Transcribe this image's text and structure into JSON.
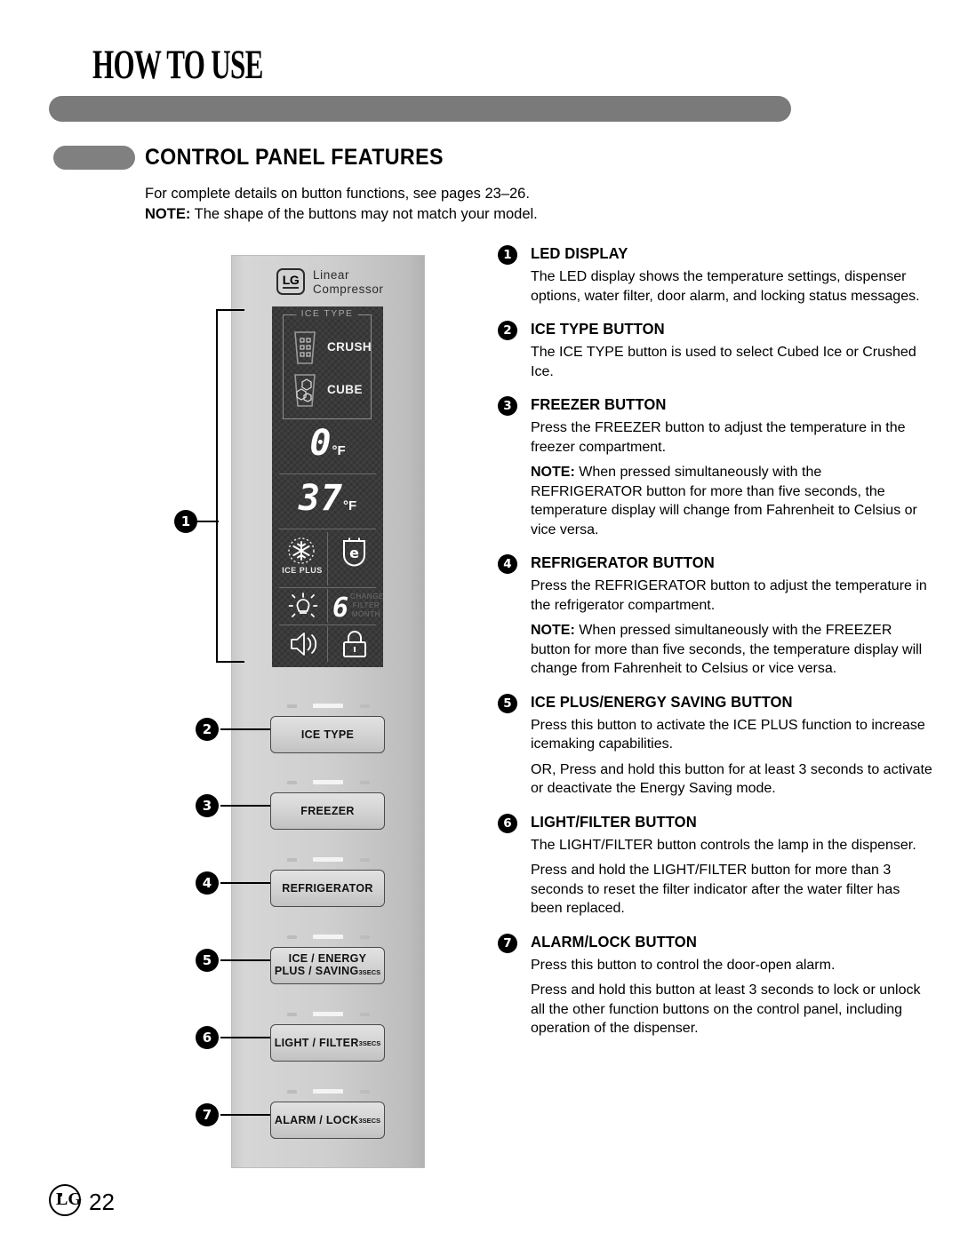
{
  "header": {
    "chapter_title": "HOW TO USE",
    "section_title": "CONTROL PANEL FEATURES"
  },
  "intro": {
    "line1": "For complete details on button functions, see pages 23–26.",
    "note_label": "NOTE:",
    "note_text": " The shape of the buttons may not match your model."
  },
  "panel": {
    "brand_badge": "LG",
    "brand_line1": "Linear",
    "brand_line2": "Compressor",
    "led": {
      "ice_type_label": "ICE TYPE",
      "crush_label": "CRUSH",
      "cube_label": "CUBE",
      "freezer_temp": "0",
      "freezer_unit": "°F",
      "fridge_temp": "37",
      "fridge_unit": "°F",
      "ice_plus_label": "ICE PLUS",
      "energy_icon": "e",
      "filter_months": "6",
      "change_filter_line1": "CHANGE",
      "change_filter_line2": "FILTER",
      "change_filter_line3": "MONTH"
    },
    "buttons": [
      {
        "label": "ICE TYPE",
        "secs": ""
      },
      {
        "label": "FREEZER",
        "secs": ""
      },
      {
        "label": "REFRIGERATOR",
        "secs": ""
      },
      {
        "line1": "ICE    / ENERGY",
        "line2": "PLUS / SAVING",
        "secs": "3SECS"
      },
      {
        "label": "LIGHT / FILTER",
        "secs": "3SECS"
      },
      {
        "label": "ALARM / LOCK",
        "secs": "3SECS"
      }
    ]
  },
  "callouts": {
    "c1": "1",
    "c2": "2",
    "c3": "3",
    "c4": "4",
    "c5": "5",
    "c6": "6",
    "c7": "7"
  },
  "features": [
    {
      "num": "1",
      "title": "LED DISPLAY",
      "paragraphs": [
        {
          "text": "The LED display shows the temperature settings, dispenser options, water filter, door alarm, and locking status messages."
        }
      ]
    },
    {
      "num": "2",
      "title": "ICE TYPE BUTTON",
      "paragraphs": [
        {
          "text": "The ICE TYPE button is used to select Cubed Ice or Crushed Ice."
        }
      ]
    },
    {
      "num": "3",
      "title": "FREEZER BUTTON",
      "paragraphs": [
        {
          "text": "Press the FREEZER button to adjust the temperature in the freezer compartment."
        },
        {
          "bold": "NOTE:",
          "text": " When pressed simultaneously with the REFRIGERATOR button for more than five seconds, the temperature display will change from Fahrenheit to Celsius or vice versa."
        }
      ]
    },
    {
      "num": "4",
      "title": "REFRIGERATOR BUTTON",
      "paragraphs": [
        {
          "text": "Press the REFRIGERATOR button to adjust the temperature in the refrigerator compartment."
        },
        {
          "bold": "NOTE:",
          "text": " When pressed simultaneously with the FREEZER button for more than five seconds, the temperature display will change from Fahrenheit to Celsius or vice versa."
        }
      ]
    },
    {
      "num": "5",
      "title": "ICE PLUS/ENERGY SAVING BUTTON",
      "paragraphs": [
        {
          "text": "Press this button to activate the ICE PLUS function to increase icemaking capabilities."
        },
        {
          "text": "OR, Press and hold this button for at least 3 seconds to activate or deactivate the Energy Saving mode."
        }
      ]
    },
    {
      "num": "6",
      "title": "LIGHT/FILTER BUTTON",
      "paragraphs": [
        {
          "text": "The LIGHT/FILTER button controls the lamp in the dispenser."
        },
        {
          "text": "Press and hold the LIGHT/FILTER button for more than 3 seconds to reset the filter indicator after the water filter has been replaced."
        }
      ]
    },
    {
      "num": "7",
      "title": "ALARM/LOCK BUTTON",
      "paragraphs": [
        {
          "text": "Press this button to control the door-open alarm."
        },
        {
          "text": "Press and hold this button at least 3 seconds to lock or unlock all the other function buttons on the control panel, including operation of the dispenser."
        }
      ]
    }
  ],
  "footer": {
    "brand": "LG",
    "page_number": "22"
  }
}
